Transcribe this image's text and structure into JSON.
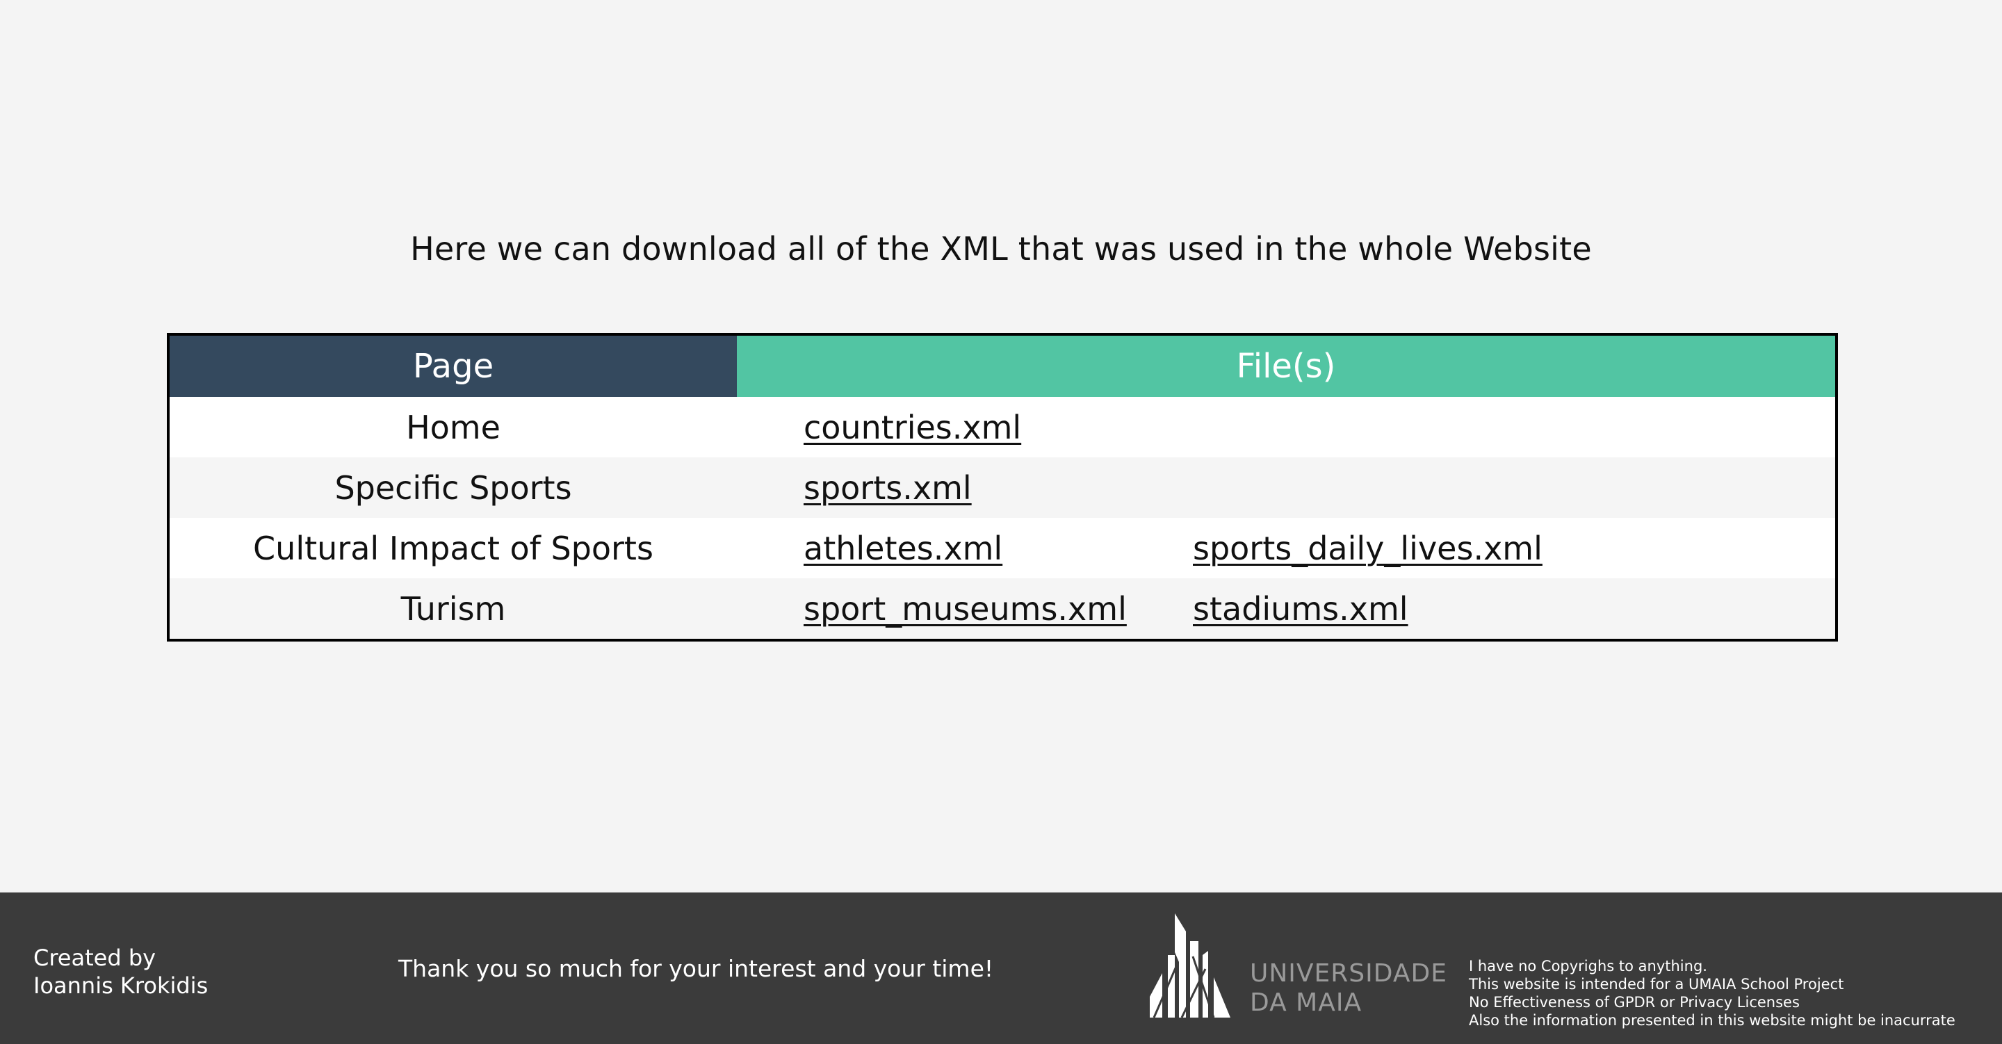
{
  "intro": "Here we can download all of the XML that was used in the whole Website",
  "table": {
    "headers": [
      "Page",
      "File(s)"
    ],
    "rows": [
      {
        "page": "Home",
        "files": [
          "countries.xml"
        ]
      },
      {
        "page": "Specific Sports",
        "files": [
          "sports.xml"
        ]
      },
      {
        "page": "Cultural Impact of Sports",
        "files": [
          "athletes.xml",
          "sports_daily_lives.xml"
        ]
      },
      {
        "page": "Turism",
        "files": [
          "sport_museums.xml",
          "stadiums.xml"
        ]
      }
    ]
  },
  "footer": {
    "created_line1": "Created by",
    "created_line2": "Ioannis Krokidis",
    "thanks": "Thank you so much for your interest and your time!",
    "logo_line1": "UNIVERSIDADE",
    "logo_line2": "DA MAIA",
    "logo_icon": "university-building-logo-icon",
    "disclaimer": [
      "I have no Copyrighs to anything.",
      "This website is intended for a UMAIA School Project",
      "No Effectiveness of GPDR or Privacy Licenses",
      "Also the information presented in this website might be inacurrate"
    ]
  },
  "colors": {
    "background": "#f4f4f4",
    "header_page": "#34495e",
    "header_files": "#52c5a3",
    "row_alt": "#f5f5f5",
    "footer": "#3b3b3b",
    "logo_gray": "#9a9a9a"
  }
}
